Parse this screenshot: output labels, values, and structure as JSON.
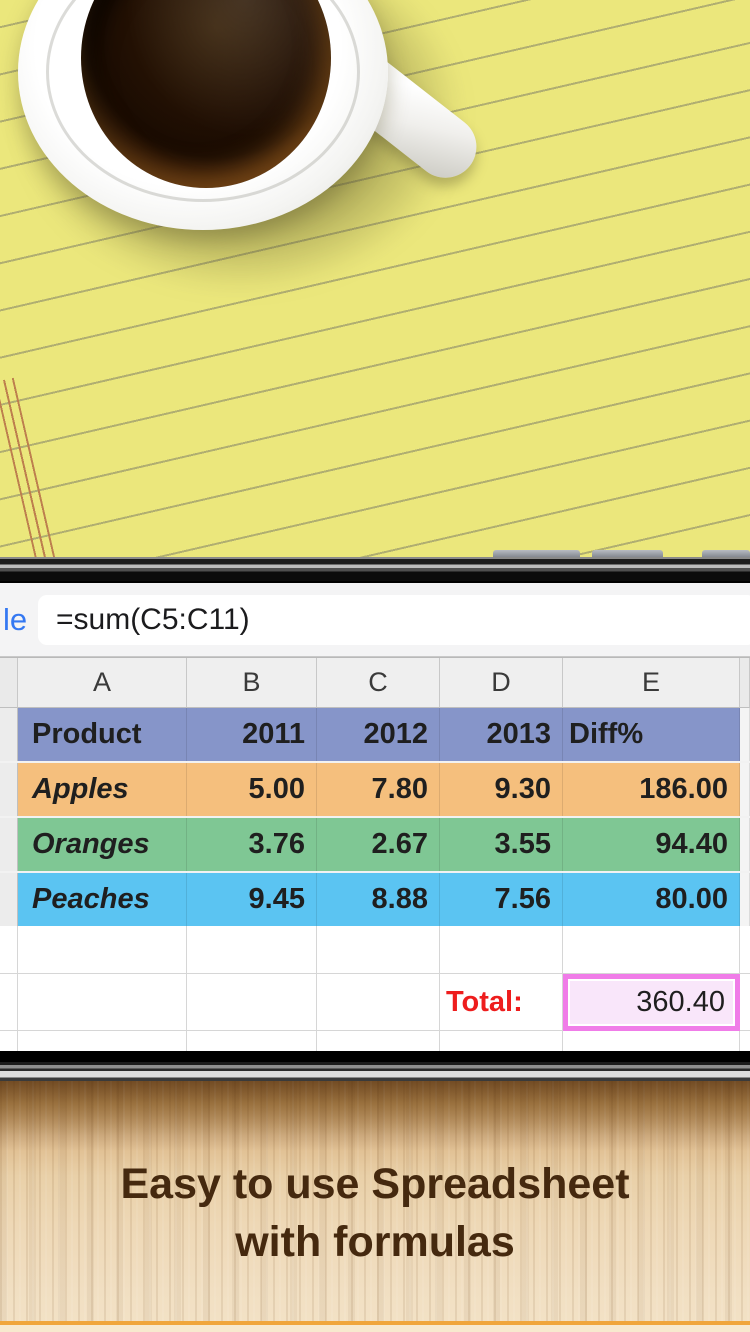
{
  "scene": {
    "caption": {
      "line1": "Easy to use Spreadsheet",
      "line2": "with formulas"
    }
  },
  "phone_screen": {
    "formula_bar": {
      "left_button_label": "le",
      "formula_value": "=sum(C5:C11)"
    },
    "spreadsheet": {
      "column_headers": [
        "A",
        "B",
        "C",
        "D",
        "E"
      ],
      "header_row": {
        "bg": "#8695c9",
        "cells": [
          "Product",
          "2011",
          "2012",
          "2013",
          "Diff%"
        ]
      },
      "rows": [
        {
          "bg": "#f5bf7d",
          "name": "Apples",
          "values": [
            "5.00",
            "7.80",
            "9.30",
            "186.00"
          ]
        },
        {
          "bg": "#7fc794",
          "name": "Oranges",
          "values": [
            "3.76",
            "2.67",
            "3.55",
            "94.40"
          ]
        },
        {
          "bg": "#5bc4f2",
          "name": "Peaches",
          "values": [
            "9.45",
            "8.88",
            "7.56",
            "80.00"
          ]
        }
      ],
      "total_row": {
        "label": "Total:",
        "value": "360.40"
      }
    }
  },
  "colors": {
    "ios_blue": "#3478f2",
    "total_label_red": "#ee1d1d",
    "selection_border_pink": "#f07ce8",
    "selection_fill_pink": "#f9e6fa",
    "notepad_yellow": "#ebe77c",
    "caption_brown": "#45290f"
  }
}
